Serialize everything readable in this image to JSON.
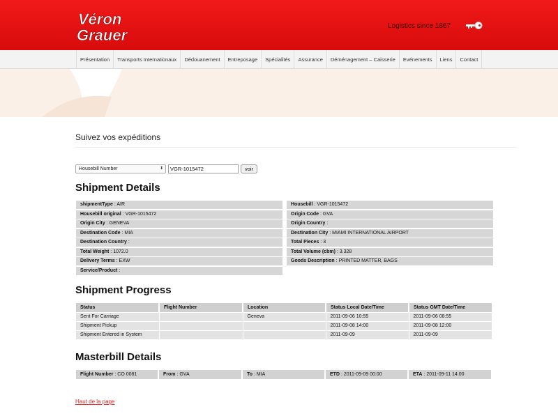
{
  "header": {
    "logo_line1": "Véron",
    "logo_line2": "Grauer",
    "tagline": "Logistics since 1867",
    "brand_color": "#e31212"
  },
  "nav": {
    "items": [
      "Présentation",
      "Transports Internationaux",
      "Dédouanement",
      "Entreposage",
      "Spécialités",
      "Assurance",
      "Déménagement – Caisserie",
      "Evénements",
      "Liens",
      "Contact"
    ]
  },
  "page": {
    "title": "Suivez vos expéditions"
  },
  "search": {
    "type_selected": "Housebill Number",
    "value": "VGR-1015472",
    "submit_label": "voir"
  },
  "shipment_details": {
    "heading": "Shipment Details",
    "rows": [
      [
        {
          "label": "shipmentType",
          "value": "AIR"
        },
        {
          "label": "Housebill",
          "value": "VGR-1015472"
        }
      ],
      [
        {
          "label": "Housebill original",
          "value": "VGR-1015472"
        },
        {
          "label": "Origin Code",
          "value": "GVA"
        }
      ],
      [
        {
          "label": "Origin City",
          "value": "GENEVA"
        },
        {
          "label": "Origin Country",
          "value": ""
        }
      ],
      [
        {
          "label": "Destination Code",
          "value": "MIA"
        },
        {
          "label": "Destination City",
          "value": "MIAMI INTERNATIONAL AIRPORT"
        }
      ],
      [
        {
          "label": "Destination Country",
          "value": ""
        },
        {
          "label": "Total Pieces",
          "value": "3"
        }
      ],
      [
        {
          "label": "Total Weight",
          "value": "1072.0"
        },
        {
          "label": "Total Volume (cbm)",
          "value": "3.328"
        }
      ],
      [
        {
          "label": "Delivery Terms",
          "value": "EXW"
        },
        {
          "label": "Goods Description",
          "value": "PRINTED MATTER, BAGS"
        }
      ],
      [
        {
          "label": "Service/Product",
          "value": ""
        },
        null
      ]
    ]
  },
  "shipment_progress": {
    "heading": "Shipment Progress",
    "columns": [
      "Status",
      "Flight Number",
      "Location",
      "Status Local Date/Time",
      "Status GMT Date/Time"
    ],
    "rows": [
      [
        "Sent For Carriage",
        "",
        "Geneva",
        "2011-09-06 10:55",
        "2011-09-06 08:55"
      ],
      [
        "Shipment Pickup",
        "",
        "",
        "2011-09-08 14:00",
        "2011-09-08 12:00"
      ],
      [
        "Shipment Entered in System",
        "",
        "",
        "2011-09-09",
        "2011-09-09"
      ]
    ]
  },
  "masterbill": {
    "heading": "Masterbill Details",
    "fields": [
      {
        "label": "Flight Number",
        "value": "CO 0081"
      },
      {
        "label": "From",
        "value": "GVA"
      },
      {
        "label": "To",
        "value": "MIA"
      },
      {
        "label": "ETD",
        "value": "2011-09-09 00:00"
      },
      {
        "label": "ETA",
        "value": "2011-09-11 14:00"
      }
    ]
  },
  "footer": {
    "back_to_top": "Haut de la page"
  }
}
